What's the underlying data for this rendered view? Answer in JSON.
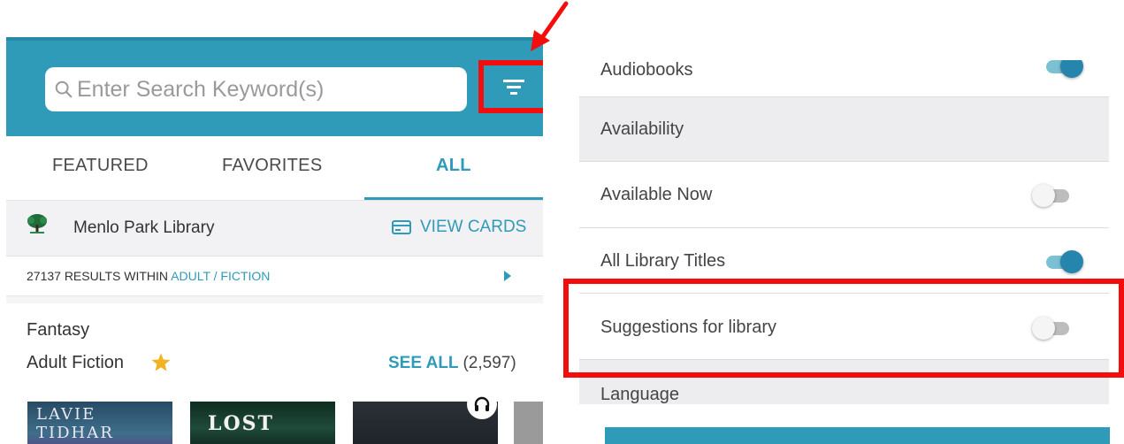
{
  "left": {
    "search": {
      "placeholder": "Enter Search Keyword(s)"
    },
    "tabs": [
      {
        "label": "FEATURED",
        "active": false
      },
      {
        "label": "FAVORITES",
        "active": false
      },
      {
        "label": "ALL",
        "active": true
      }
    ],
    "library": {
      "name": "Menlo Park Library",
      "view_cards_label": "VIEW CARDS"
    },
    "results": {
      "count_text": "27137 RESULTS WITHIN",
      "category": "ADULT / FICTION"
    },
    "shelf": {
      "title": "Fantasy",
      "subtitle": "Adult Fiction",
      "see_all_label": "SEE ALL",
      "see_all_count": "(2,597)"
    },
    "covers": [
      {
        "text": "LAVIE TIDHAR"
      },
      {
        "text": "LOST"
      },
      {
        "text": ""
      },
      {
        "text": ""
      }
    ]
  },
  "right": {
    "rows": [
      {
        "label": "Audiobooks",
        "type": "toggle",
        "on": true
      },
      {
        "label": "Availability",
        "type": "section"
      },
      {
        "label": "Available Now",
        "type": "toggle",
        "on": false
      },
      {
        "label": "All Library Titles",
        "type": "toggle",
        "on": true
      },
      {
        "label": "Suggestions for library",
        "type": "toggle",
        "on": false
      },
      {
        "label": "Language",
        "type": "section"
      }
    ]
  },
  "colors": {
    "brand": "#2f9bb9",
    "annotation": "#f30d0d",
    "toggle_on": "#2585ad"
  }
}
